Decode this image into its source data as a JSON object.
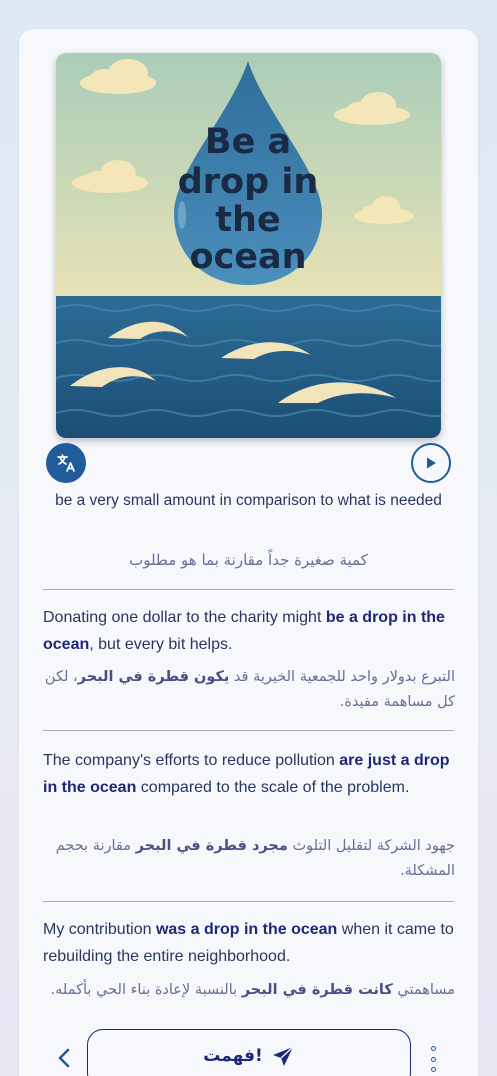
{
  "illustration": {
    "title_lines": [
      "Be a",
      "drop in",
      "the",
      "ocean"
    ],
    "icon": "water-drop-over-ocean-illustration"
  },
  "controls": {
    "translate_icon": "translate-icon",
    "play_icon": "play-icon"
  },
  "meaning": {
    "en": "be a very small amount in comparison to what is needed",
    "ar": "كمية صغيرة جداً مقارنة بما هو مطلوب"
  },
  "examples": [
    {
      "en_before": "Donating one dollar to the charity might ",
      "en_bold": "be a drop in the ocean",
      "en_after": ", but every bit helps.",
      "ar_before": "التبرع بدولار واحد للجمعية الخيرية قد ",
      "ar_bold": "يكون قطرة في البحر",
      "ar_after": "، لكن كل مساهمة مفيدة."
    },
    {
      "en_before": "The company's efforts to reduce pollution ",
      "en_bold": "are just a drop in the ocean",
      "en_after": " compared to the scale of the problem.",
      "ar_before": "جهود الشركة لتقليل التلوث ",
      "ar_bold": "مجرد قطرة في البحر",
      "ar_after": " مقارنة بحجم المشكلة.",
      "ar_before2": ""
    },
    {
      "en_before": "My contribution ",
      "en_bold": "was a drop in the ocean",
      "en_after": " when it came to rebuilding the entire neighborhood.",
      "ar_before": "مساهمتي ",
      "ar_bold": "كانت قطرة في البحر",
      "ar_after": " بالنسبة لإعادة بناء الحي بأكمله."
    }
  ],
  "footer": {
    "got_it_label": "فهمت!",
    "got_it_icon": "send-icon",
    "back_icon": "chevron-left-icon",
    "more_icon": "more-vertical-icon"
  },
  "colors": {
    "primary": "#1f5c99",
    "heading": "#1f2778",
    "text": "#2a3560",
    "muted": "#6a6d97"
  }
}
